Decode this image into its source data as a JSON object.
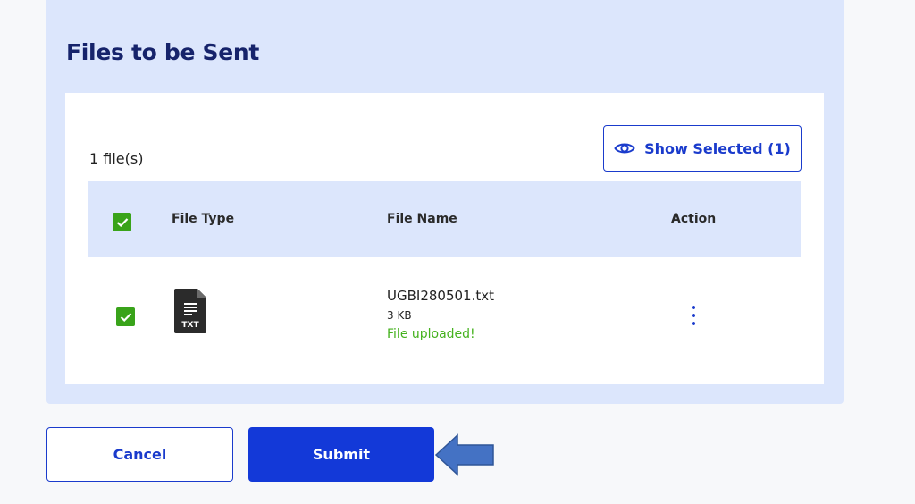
{
  "panel": {
    "title": "Files to be Sent"
  },
  "file_count": "1 file(s)",
  "show_selected": {
    "label": "Show Selected (1)",
    "icon": "eye-icon"
  },
  "table": {
    "headers": {
      "file_type": "File Type",
      "file_name": "File Name",
      "action": "Action"
    },
    "select_all_checked": true,
    "rows": [
      {
        "checked": true,
        "type_badge": "TXT",
        "file_name": "UGBI280501.txt",
        "size": "3 KB",
        "status": "File uploaded!"
      }
    ]
  },
  "buttons": {
    "cancel": "Cancel",
    "submit": "Submit"
  },
  "colors": {
    "panel_bg": "#dce6fc",
    "primary": "#1a3bcc",
    "success": "#45b21e",
    "title": "#16236b",
    "annotation_arrow": "#4472c4"
  }
}
